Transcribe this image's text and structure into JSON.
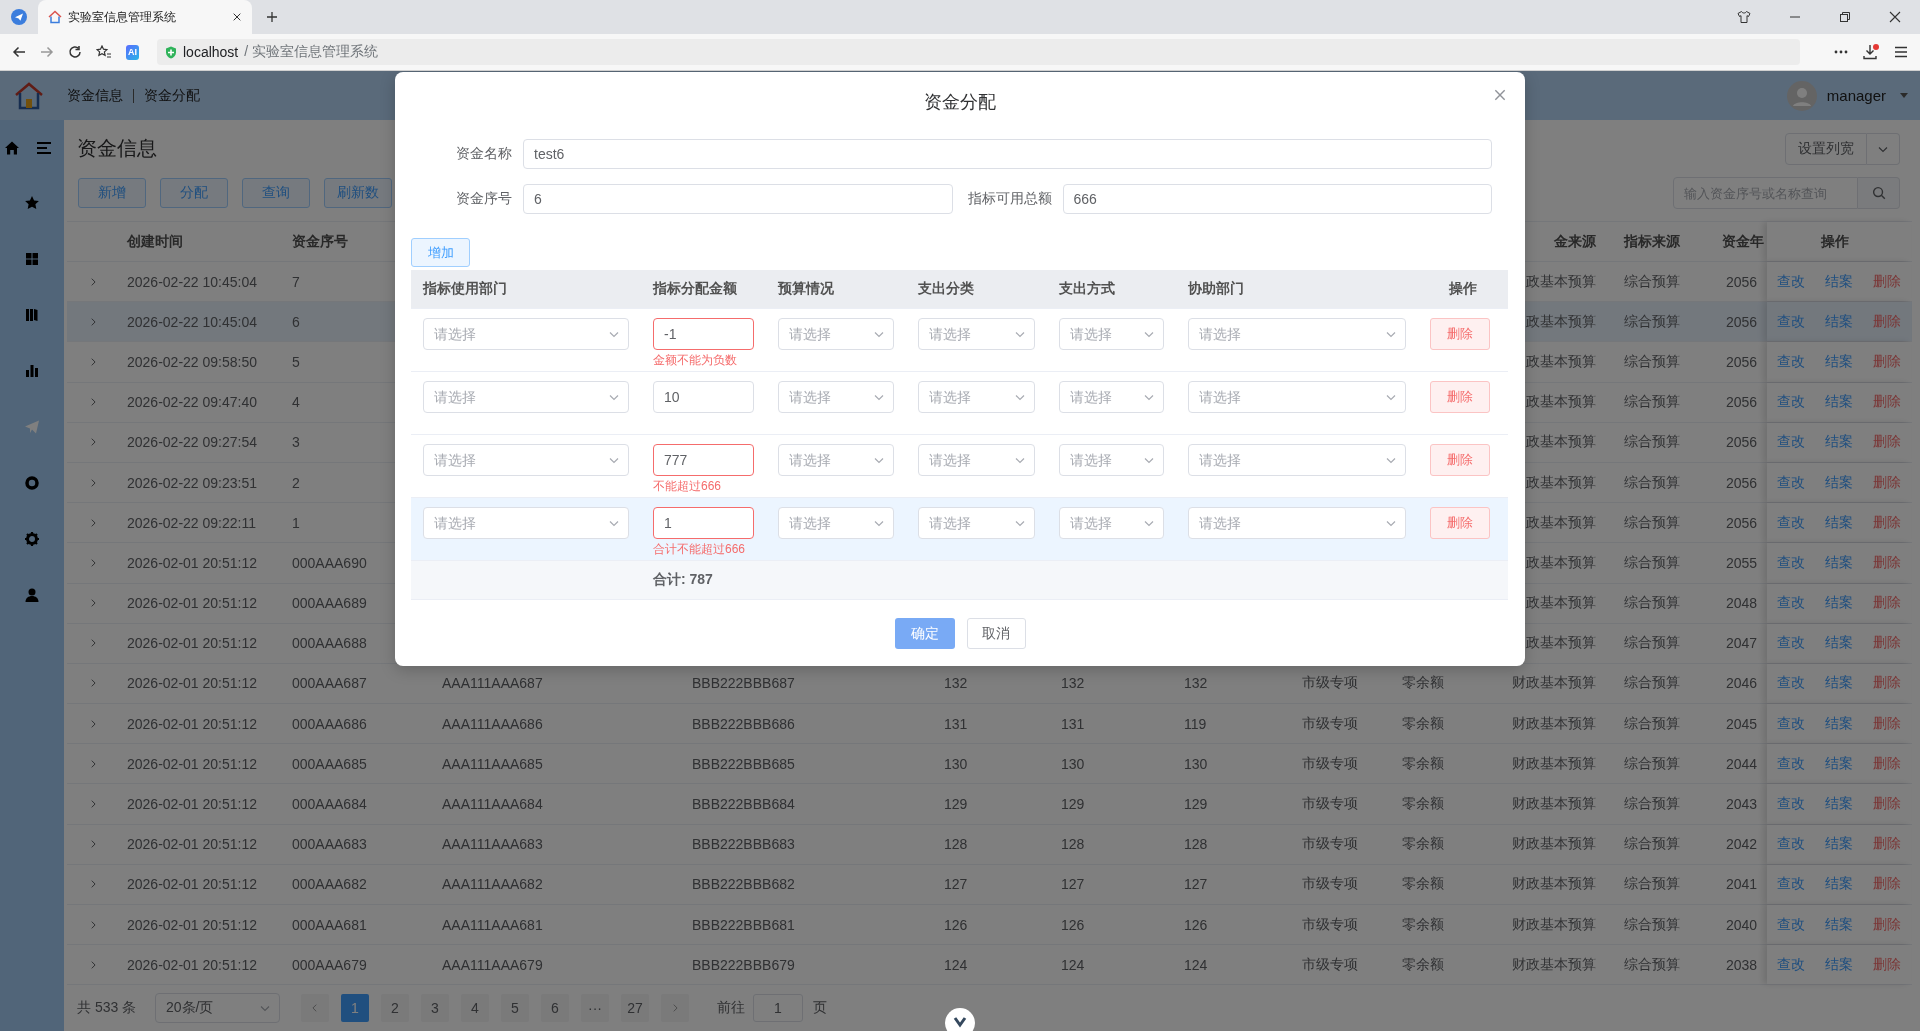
{
  "browser": {
    "tab_title": "实验室信息管理系统",
    "ai_badge": "AI",
    "url_host": "localhost",
    "url_path": "/ 实验室信息管理系统"
  },
  "header": {
    "breadcrumbs": [
      "资金信息",
      "资金分配"
    ],
    "user": "manager"
  },
  "sidebar": {
    "items": [
      {
        "selected": false
      },
      {
        "selected": false
      },
      {
        "selected": false
      },
      {
        "selected": false
      },
      {
        "selected": true
      },
      {
        "selected": false
      },
      {
        "selected": false
      },
      {
        "selected": false
      }
    ]
  },
  "page": {
    "title": "资金信息",
    "buttons": [
      "新增",
      "分配",
      "查询",
      "刷新数"
    ],
    "column_width_button": "设置列宽",
    "search": {
      "placeholder": "输入资金序号或名称查询"
    }
  },
  "table": {
    "columns": [
      "创建时间",
      "资金序号",
      "金来源",
      "指标来源",
      "资金年"
    ],
    "actions_label": "操作",
    "rows": [
      {
        "kind": "partial",
        "selected": false,
        "cells": [
          "2026-02-22 10:45:04",
          "7",
          "政基本预算",
          "综合预算",
          "2056"
        ],
        "actions": [
          "查改",
          "结案",
          "删除"
        ]
      },
      {
        "kind": "partial",
        "selected": true,
        "cells": [
          "2026-02-22 10:45:04",
          "6",
          "政基本预算",
          "综合预算",
          "2056"
        ],
        "actions": [
          "查改",
          "结案",
          "删除"
        ]
      },
      {
        "kind": "partial",
        "selected": false,
        "cells": [
          "2026-02-22 09:58:50",
          "5",
          "政基本预算",
          "综合预算",
          "2056"
        ],
        "actions": [
          "查改",
          "结案",
          "删除"
        ]
      },
      {
        "kind": "partial",
        "selected": false,
        "cells": [
          "2026-02-22 09:47:40",
          "4",
          "政基本预算",
          "综合预算",
          "2056"
        ],
        "actions": [
          "查改",
          "结案",
          "删除"
        ]
      },
      {
        "kind": "partial",
        "selected": false,
        "cells": [
          "2026-02-22 09:27:54",
          "3",
          "政基本预算",
          "综合预算",
          "2056"
        ],
        "actions": [
          "查改",
          "结案",
          "删除"
        ]
      },
      {
        "kind": "partial",
        "selected": false,
        "cells": [
          "2026-02-22 09:23:51",
          "2",
          "政基本预算",
          "综合预算",
          "2056"
        ],
        "actions": [
          "查改",
          "结案",
          "删除"
        ]
      },
      {
        "kind": "partial",
        "selected": false,
        "cells": [
          "2026-02-22 09:22:11",
          "1",
          "政基本预算",
          "综合预算",
          "2056"
        ],
        "actions": [
          "查改",
          "结案",
          "删除"
        ]
      },
      {
        "kind": "partial",
        "selected": false,
        "cells": [
          "2026-02-01 20:51:12",
          "000AAA690",
          "政基本预算",
          "综合预算",
          "2055"
        ],
        "actions": [
          "查改",
          "结案",
          "删除"
        ]
      },
      {
        "kind": "partial",
        "selected": false,
        "cells": [
          "2026-02-01 20:51:12",
          "000AAA689",
          "政基本预算",
          "综合预算",
          "2048"
        ],
        "actions": [
          "查改",
          "结案",
          "删除"
        ]
      },
      {
        "kind": "partial",
        "selected": false,
        "cells": [
          "2026-02-01 20:51:12",
          "000AAA688",
          "政基本预算",
          "综合预算",
          "2047"
        ],
        "actions": [
          "查改",
          "结案",
          "删除"
        ]
      },
      {
        "kind": "full",
        "selected": false,
        "cells": [
          "2026-02-01 20:51:12",
          "000AAA687",
          "AAA111AAA687",
          "BBB222BBB687",
          "132",
          "132",
          "132",
          "市级专项",
          "零余额",
          "财政基本预算",
          "综合预算",
          "2046"
        ],
        "actions": [
          "查改",
          "结案",
          "删除"
        ]
      },
      {
        "kind": "full",
        "selected": false,
        "cells": [
          "2026-02-01 20:51:12",
          "000AAA686",
          "AAA111AAA686",
          "BBB222BBB686",
          "131",
          "131",
          "119",
          "市级专项",
          "零余额",
          "财政基本预算",
          "综合预算",
          "2045"
        ],
        "actions": [
          "查改",
          "结案",
          "删除"
        ]
      },
      {
        "kind": "full",
        "selected": false,
        "cells": [
          "2026-02-01 20:51:12",
          "000AAA685",
          "AAA111AAA685",
          "BBB222BBB685",
          "130",
          "130",
          "130",
          "市级专项",
          "零余额",
          "财政基本预算",
          "综合预算",
          "2044"
        ],
        "actions": [
          "查改",
          "结案",
          "删除"
        ]
      },
      {
        "kind": "full",
        "selected": false,
        "cells": [
          "2026-02-01 20:51:12",
          "000AAA684",
          "AAA111AAA684",
          "BBB222BBB684",
          "129",
          "129",
          "129",
          "市级专项",
          "零余额",
          "财政基本预算",
          "综合预算",
          "2043"
        ],
        "actions": [
          "查改",
          "结案",
          "删除"
        ]
      },
      {
        "kind": "full",
        "selected": false,
        "cells": [
          "2026-02-01 20:51:12",
          "000AAA683",
          "AAA111AAA683",
          "BBB222BBB683",
          "128",
          "128",
          "128",
          "市级专项",
          "零余额",
          "财政基本预算",
          "综合预算",
          "2042"
        ],
        "actions": [
          "查改",
          "结案",
          "删除"
        ]
      },
      {
        "kind": "full",
        "selected": false,
        "cells": [
          "2026-02-01 20:51:12",
          "000AAA682",
          "AAA111AAA682",
          "BBB222BBB682",
          "127",
          "127",
          "127",
          "市级专项",
          "零余额",
          "财政基本预算",
          "综合预算",
          "2041"
        ],
        "actions": [
          "查改",
          "结案",
          "删除"
        ]
      },
      {
        "kind": "full",
        "selected": false,
        "cells": [
          "2026-02-01 20:51:12",
          "000AAA681",
          "AAA111AAA681",
          "BBB222BBB681",
          "126",
          "126",
          "126",
          "市级专项",
          "零余额",
          "财政基本预算",
          "综合预算",
          "2040"
        ],
        "actions": [
          "查改",
          "结案",
          "删除"
        ]
      },
      {
        "kind": "full",
        "selected": false,
        "cells": [
          "2026-02-01 20:51:12",
          "000AAA679",
          "AAA111AAA679",
          "BBB222BBB679",
          "124",
          "124",
          "124",
          "市级专项",
          "零余额",
          "财政基本预算",
          "综合预算",
          "2038"
        ],
        "actions": [
          "查改",
          "结案",
          "删除"
        ]
      }
    ]
  },
  "pagination": {
    "total": "共 533 条",
    "page_size": "20条/页",
    "pages": [
      {
        "label": "1",
        "selected": true
      },
      {
        "label": "2",
        "selected": false
      },
      {
        "label": "3",
        "selected": false
      },
      {
        "label": "4",
        "selected": false
      },
      {
        "label": "5",
        "selected": false
      },
      {
        "label": "6",
        "selected": false
      },
      {
        "label": "···",
        "selected": false
      },
      {
        "label": "27",
        "selected": false
      }
    ],
    "goto_label": "前往",
    "goto_value": "1",
    "page_suffix": "页"
  },
  "dialog": {
    "title": "资金分配",
    "fields": [
      {
        "label": "资金名称",
        "value": "test6"
      },
      {
        "label": "资金序号",
        "value": "6"
      },
      {
        "label": "指标可用总额",
        "value": "666"
      }
    ],
    "add_button": "增加",
    "columns": [
      "指标使用部门",
      "指标分配金额",
      "预算情况",
      "支出分类",
      "支出方式",
      "协助部门",
      "操作"
    ],
    "rows": [
      {
        "hovered": false,
        "department": {
          "placeholder": "请选择"
        },
        "amount": {
          "value": "-1",
          "error": "金额不能为负数"
        },
        "budget_status": {
          "placeholder": "请选择"
        },
        "expense_category": {
          "placeholder": "请选择"
        },
        "payment_method": {
          "placeholder": "请选择"
        },
        "assist_department": {
          "placeholder": "请选择"
        },
        "delete_button": "删除"
      },
      {
        "hovered": false,
        "department": {
          "placeholder": "请选择"
        },
        "amount": {
          "value": "10"
        },
        "budget_status": {
          "placeholder": "请选择"
        },
        "expense_category": {
          "placeholder": "请选择"
        },
        "payment_method": {
          "placeholder": "请选择"
        },
        "assist_department": {
          "placeholder": "请选择"
        },
        "delete_button": "删除"
      },
      {
        "hovered": false,
        "department": {
          "placeholder": "请选择"
        },
        "amount": {
          "value": "777",
          "error": "不能超过666"
        },
        "budget_status": {
          "placeholder": "请选择"
        },
        "expense_category": {
          "placeholder": "请选择"
        },
        "payment_method": {
          "placeholder": "请选择"
        },
        "assist_department": {
          "placeholder": "请选择"
        },
        "delete_button": "删除"
      },
      {
        "hovered": true,
        "department": {
          "placeholder": "请选择"
        },
        "amount": {
          "value": "1",
          "error": "合计不能超过666"
        },
        "budget_status": {
          "placeholder": "请选择"
        },
        "expense_category": {
          "placeholder": "请选择"
        },
        "payment_method": {
          "placeholder": "请选择"
        },
        "assist_department": {
          "placeholder": "请选择"
        },
        "delete_button": "删除"
      }
    ],
    "total": "合计: 787",
    "confirm_button": "确定",
    "cancel_button": "取消"
  }
}
